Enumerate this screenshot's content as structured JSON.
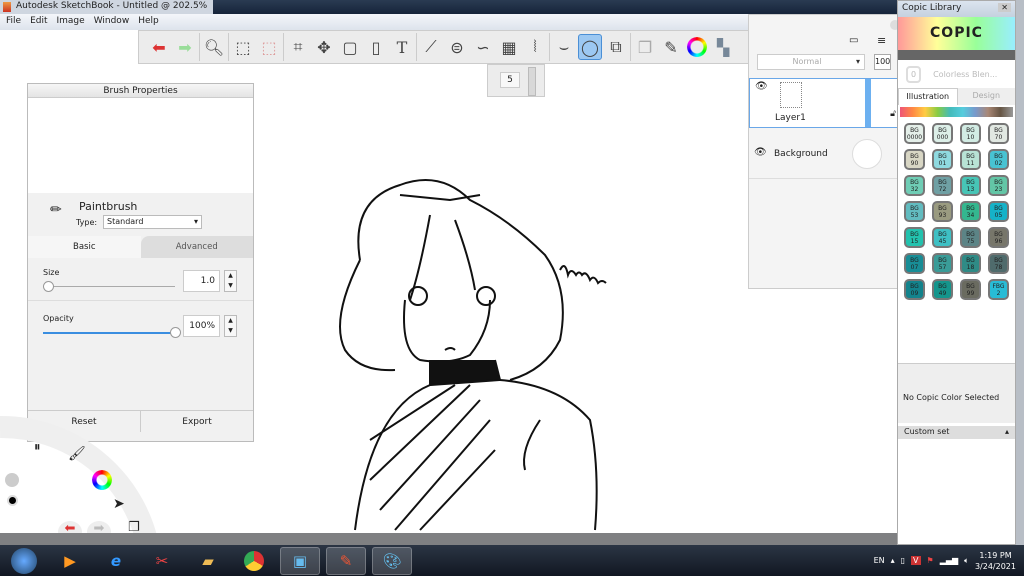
{
  "window": {
    "title": "Autodesk SketchBook - Untitled @ 202.5%"
  },
  "menu": [
    "File",
    "Edit",
    "Image",
    "Window",
    "Help"
  ],
  "toolbar": {
    "tools": [
      "undo",
      "redo",
      "zoom",
      "select",
      "select-add",
      "crop",
      "transform",
      "distort",
      "fill",
      "text",
      "ruler",
      "ellipse",
      "french-curve",
      "perspective",
      "symmetry",
      "stroke",
      "predictive-stroke",
      "shape",
      "copy",
      "brushes",
      "color",
      "palette"
    ],
    "active": "predictive-stroke"
  },
  "brush_size_popup": {
    "value": "5"
  },
  "brush_properties": {
    "title": "Brush Properties",
    "brush_name": "Paintbrush",
    "type_label": "Type:",
    "type_value": "Standard",
    "tab_basic": "Basic",
    "tab_advanced": "Advanced",
    "size_label": "Size",
    "size_value": "1.0",
    "opacity_label": "Opacity",
    "opacity_value": "100%",
    "opacity_fraction": 1.0,
    "reset": "Reset",
    "export": "Export"
  },
  "layers": {
    "blend_mode": "Normal",
    "opacity": "100",
    "items": [
      {
        "name": "Layer1",
        "selected": true
      },
      {
        "name": "Background",
        "selected": false
      }
    ]
  },
  "copic": {
    "title": "Copic Library",
    "logo": "COPIC",
    "colorless": "Colorless Blen...",
    "colorless_code": "0",
    "tab_illustration": "Illustration",
    "tab_design": "Design",
    "no_selection": "No Copic Color Selected",
    "custom_set": "Custom set",
    "chips": [
      {
        "code": "BG\n0000",
        "color": "#e4efe9"
      },
      {
        "code": "BG\n000",
        "color": "#dcefe8"
      },
      {
        "code": "BG\n10",
        "color": "#d2ece4"
      },
      {
        "code": "BG\n70",
        "color": "#e1e8e2"
      },
      {
        "code": "BG\n90",
        "color": "#d8d6c4"
      },
      {
        "code": "BG\n01",
        "color": "#8fd9df"
      },
      {
        "code": "BG\n11",
        "color": "#b8e3d5"
      },
      {
        "code": "BG\n02",
        "color": "#48c3d2"
      },
      {
        "code": "BG\n32",
        "color": "#6fcdb5"
      },
      {
        "code": "BG\n72",
        "color": "#6fa0a4"
      },
      {
        "code": "BG\n13",
        "color": "#47c5b6"
      },
      {
        "code": "BG\n23",
        "color": "#63c6a6"
      },
      {
        "code": "BG\n53",
        "color": "#62bcc0"
      },
      {
        "code": "BG\n93",
        "color": "#9a9b80"
      },
      {
        "code": "BG\n34",
        "color": "#34b78f"
      },
      {
        "code": "BG\n05",
        "color": "#15b2c8"
      },
      {
        "code": "BG\n15",
        "color": "#23c2ae"
      },
      {
        "code": "BG\n45",
        "color": "#3ec0c4"
      },
      {
        "code": "BG\n75",
        "color": "#5c8486"
      },
      {
        "code": "BG\n96",
        "color": "#77766a"
      },
      {
        "code": "BG\n07",
        "color": "#188d96"
      },
      {
        "code": "BG\n57",
        "color": "#3a9c98"
      },
      {
        "code": "BG\n18",
        "color": "#2f8b86"
      },
      {
        "code": "BG\n78",
        "color": "#4f6b6c"
      },
      {
        "code": "BG\n09",
        "color": "#13838c"
      },
      {
        "code": "BG\n49",
        "color": "#14958c"
      },
      {
        "code": "BG\n99",
        "color": "#6a6b60"
      },
      {
        "code": "FBG\n2",
        "color": "#28bcd6"
      }
    ]
  },
  "canvas": {
    "signature": "Kazy"
  },
  "taskbar": {
    "apps": [
      "start",
      "media-player",
      "internet-explorer",
      "snipping-tool",
      "file-explorer",
      "chrome",
      "photo-viewer",
      "sketchbook",
      "paint"
    ],
    "active": "sketchbook",
    "language": "EN",
    "time": "1:19 PM",
    "date": "3/24/2021"
  }
}
